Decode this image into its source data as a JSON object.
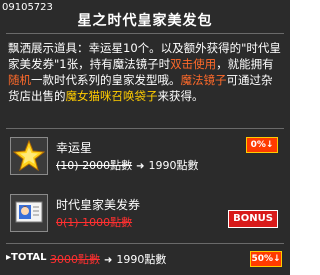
{
  "item_id": "09105723",
  "title": "星之时代皇家美发包",
  "description": {
    "p1": "飘洒展示道具：幸运星10个。以及额外获得的\"时代皇家美发券\"1张，持有魔法镜子时",
    "p2": "双击使用",
    "p3": "，就能拥有",
    "p4": "随机",
    "p5": "一款时代系列的皇家发型哦。",
    "p6": "魔法镜子",
    "p7": "可通过",
    "p8": "杂货店出售的",
    "p9": "魔女猫咪召唤袋子",
    "p10": "来获得。"
  },
  "items": [
    {
      "name": "幸运星",
      "original_price": "(10) 2000點數",
      "arrow": "➜",
      "new_price": "1990點數",
      "badge": "0%↓",
      "icon": "lucky-star-icon"
    },
    {
      "name": "时代皇家美发券",
      "original_price": "0(1) 1000點數",
      "badge": "BONUS",
      "icon": "hair-coupon-icon"
    }
  ],
  "total": {
    "label": "▸TOTAL",
    "original": "3000點數",
    "arrow": "➜",
    "new": "1990點數",
    "badge": "50%↓"
  },
  "colors": {
    "background": "#2b2b2b",
    "highlight_orange": "#ff6a2a",
    "highlight_yellow": "#ffcc00",
    "strike_red": "#ff3030"
  }
}
